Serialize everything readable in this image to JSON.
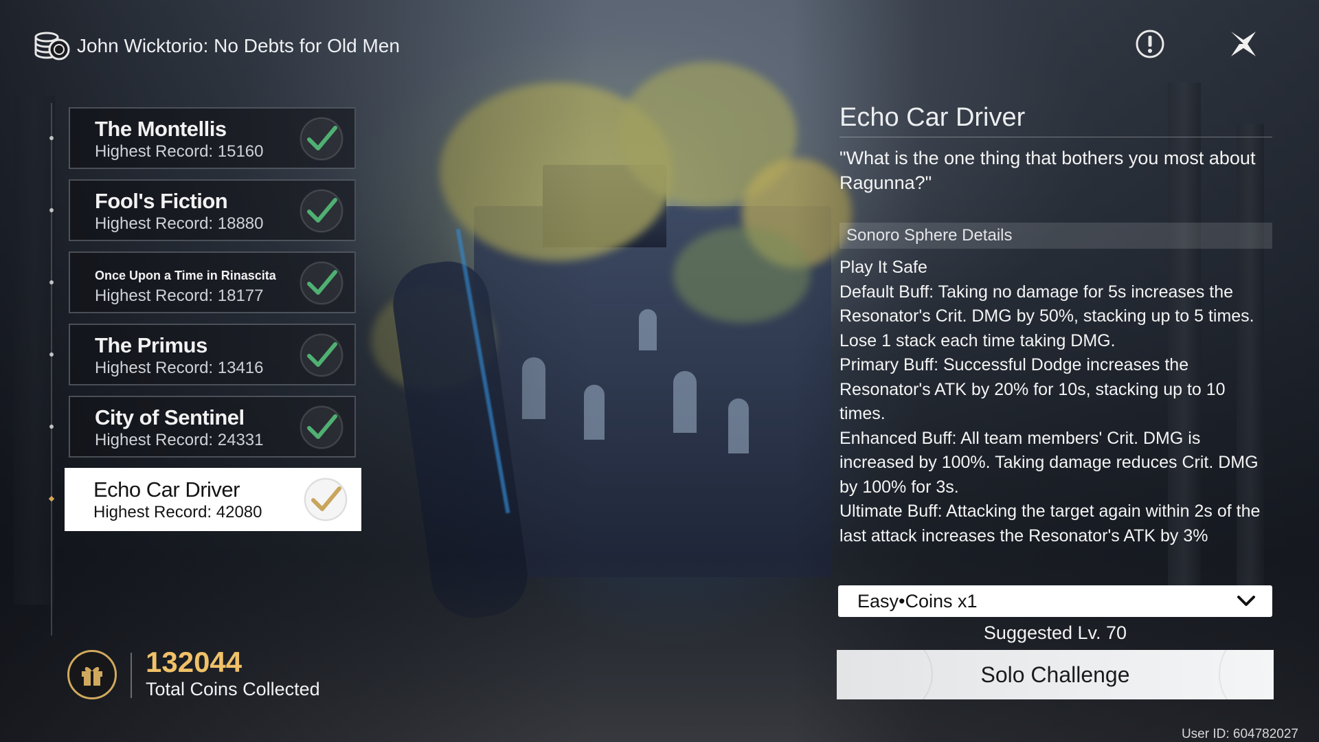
{
  "header": {
    "title": "John Wicktorio: No Debts for Old Men",
    "icon": "coin-stack-icon"
  },
  "top_buttons": {
    "info_icon": "exclamation-icon",
    "close_icon": "close-star-icon"
  },
  "missions": [
    {
      "name": "The Montellis",
      "record": "Highest Record: 15160",
      "completed": true
    },
    {
      "name": "Fool's Fiction",
      "record": "Highest Record: 18880",
      "completed": true
    },
    {
      "name": "Once Upon a Time in Rinascita",
      "record": "Highest Record: 18177",
      "completed": true
    },
    {
      "name": "The Primus",
      "record": "Highest Record: 13416",
      "completed": true
    },
    {
      "name": "City of Sentinel",
      "record": "Highest Record: 24331",
      "completed": true
    },
    {
      "name": "Echo Car Driver",
      "record": "Highest Record: 42080",
      "completed": true,
      "selected": true
    }
  ],
  "coins": {
    "total": "132044",
    "label": "Total Coins Collected",
    "icon": "gift-icon"
  },
  "detail": {
    "title": "Echo Car Driver",
    "quote": "\"What is the one thing that bothers you most about Ragunna?\"",
    "section_label": "Sonoro Sphere Details",
    "lines": [
      "Play It Safe",
      "Default Buff: Taking no damage for 5s increases the Resonator's Crit. DMG by 50%, stacking up to 5 times. Lose 1 stack each time taking DMG.",
      "Primary Buff: Successful Dodge increases the Resonator's ATK by 20% for 10s, stacking up to 10 times.",
      "Enhanced Buff: All team members' Crit. DMG is increased by 100%. Taking damage reduces Crit. DMG by 100% for 3s.",
      "Ultimate Buff: Attacking the target again within 2s of the last attack increases the Resonator's ATK by 3%"
    ]
  },
  "difficulty": {
    "selected": "Easy•Coins x1"
  },
  "suggested_level": "Suggested Lv. 70",
  "solo_button": "Solo Challenge",
  "user_id": "User ID: 604782027",
  "colors": {
    "accent_gold": "#f0c169",
    "check_green": "#4fb072",
    "check_gold": "#c9a55c"
  }
}
